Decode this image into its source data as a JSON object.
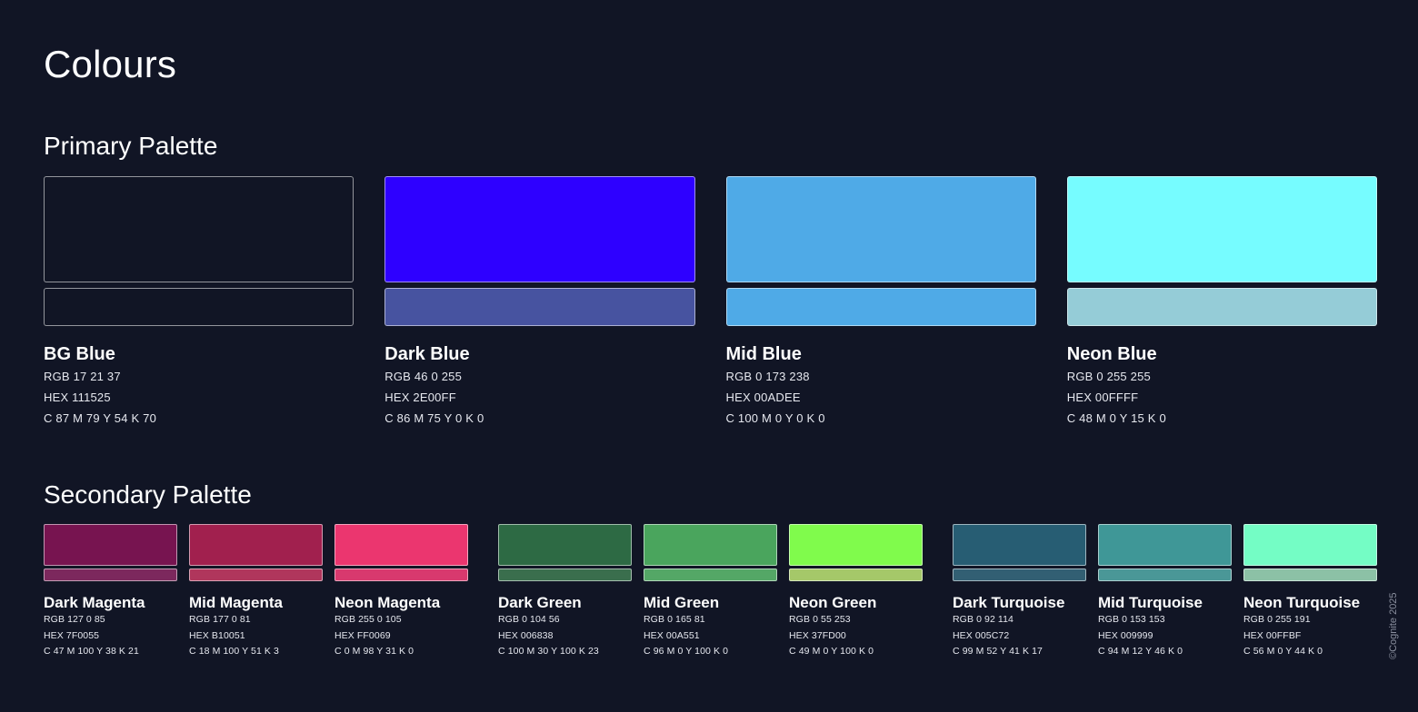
{
  "page_title": "Colours",
  "copyright": "©Cognite 2025",
  "primary": {
    "title": "Primary Palette",
    "colors": [
      {
        "name": "BG Blue",
        "rgb": "RGB 17 21 37",
        "hex": "HEX 111525",
        "cmyk": "C 87   M 79   Y 54   K 70",
        "swatch": "#111525",
        "tint": "#111525"
      },
      {
        "name": "Dark Blue",
        "rgb": "RGB 46 0 255",
        "hex": "HEX 2E00FF",
        "cmyk": "C 86   M 75   Y 0   K 0",
        "swatch": "#2E00FF",
        "tint": "#4753A0"
      },
      {
        "name": "Mid Blue",
        "rgb": "RGB 0 173 238",
        "hex": "HEX 00ADEE",
        "cmyk": "C 100   M 0   Y 0   K 0",
        "swatch": "#4FAAE7",
        "tint": "#4FAAE7"
      },
      {
        "name": "Neon Blue",
        "rgb": "RGB 0 255 255",
        "hex": "HEX 00FFFF",
        "cmyk": "C 48   M 0   Y 15   K 0",
        "swatch": "#76FCFF",
        "tint": "#95CCD7"
      }
    ]
  },
  "secondary": {
    "title": "Secondary Palette",
    "groups": [
      [
        {
          "name": "Dark Magenta",
          "rgb": "RGB 127 0 85",
          "hex": "HEX 7F0055",
          "cmyk": "C 47   M 100   Y 38   K 21",
          "swatch": "#771450",
          "tint": "#7C285D"
        },
        {
          "name": "Mid Magenta",
          "rgb": "RGB 177 0 81",
          "hex": "HEX B10051",
          "cmyk": "C 18   M 100   Y 51   K 3",
          "swatch": "#A1204E",
          "tint": "#B0365C"
        },
        {
          "name": "Neon Magenta",
          "rgb": "RGB 255 0 105",
          "hex": "HEX FF0069",
          "cmyk": "C 0   M 98   Y 31   K 0",
          "swatch": "#EB366F",
          "tint": "#D8396E"
        }
      ],
      [
        {
          "name": "Dark Green",
          "rgb": "RGB 0 104 56",
          "hex": "HEX 006838",
          "cmyk": "C 100   M 30   Y 100   K 23",
          "swatch": "#2D6A44",
          "tint": "#3A6E4D"
        },
        {
          "name": "Mid Green",
          "rgb": "RGB 0 165 81",
          "hex": "HEX 00A551",
          "cmyk": "C 96   M 0   Y 100   K 0",
          "swatch": "#4AA55D",
          "tint": "#54A766"
        },
        {
          "name": "Neon Green",
          "rgb": "RGB 0 55 253",
          "hex": "HEX 37FD00",
          "cmyk": "C 49   M 0   Y 100   K 0",
          "swatch": "#80FB4C",
          "tint": "#A5C869"
        }
      ],
      [
        {
          "name": "Dark Turquoise",
          "rgb": "RGB 0 92 114",
          "hex": "HEX 005C72",
          "cmyk": "C 99   M 52   Y 41   K 17",
          "swatch": "#275D73",
          "tint": "#325F73"
        },
        {
          "name": "Mid Turquoise",
          "rgb": "RGB 0 153 153",
          "hex": "HEX 009999",
          "cmyk": "C 94   M 12   Y 46   K 0",
          "swatch": "#3F9797",
          "tint": "#4A9797"
        },
        {
          "name": "Neon Turquoise",
          "rgb": "RGB 0 255 191",
          "hex": "HEX 00FFBF",
          "cmyk": "C 56   M 0   Y 44   K 0",
          "swatch": "#74FDC5",
          "tint": "#8CC1A6"
        }
      ]
    ]
  }
}
